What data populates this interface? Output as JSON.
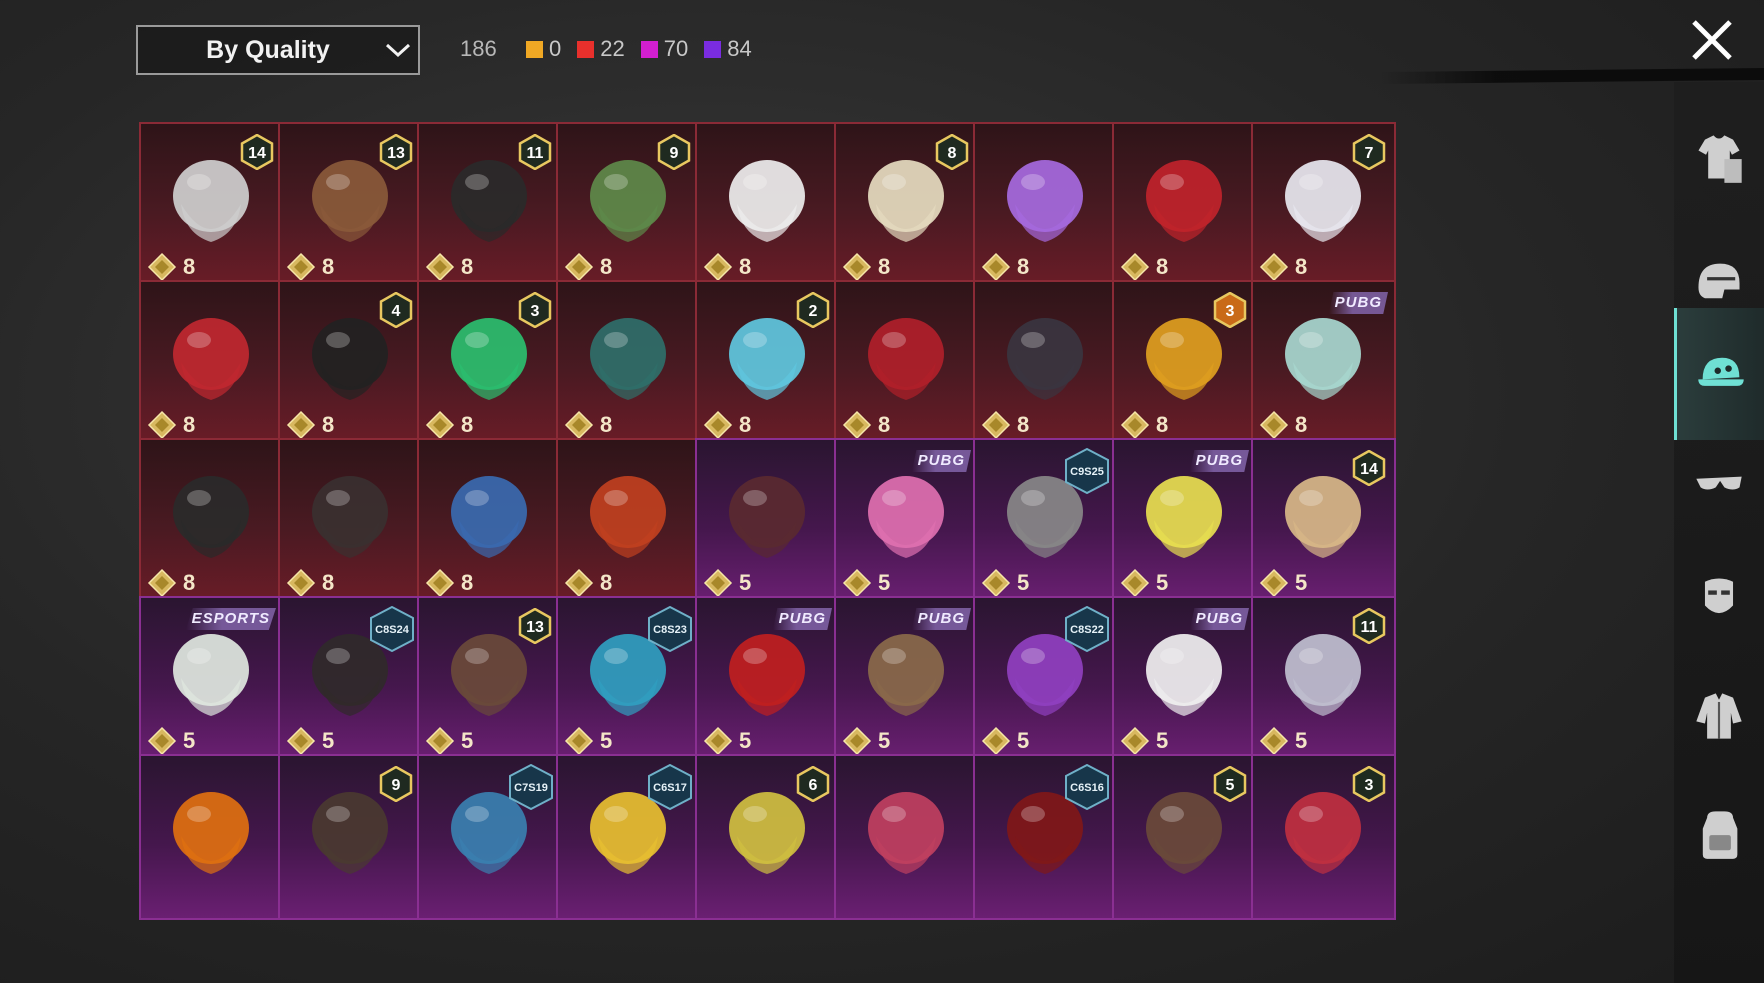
{
  "toolbar": {
    "sort_label": "By Quality",
    "total_count": "186",
    "quality_counts": [
      {
        "color": "#f0a824",
        "value": "0"
      },
      {
        "color": "#e8302c",
        "value": "22"
      },
      {
        "color": "#d21fd0",
        "value": "70"
      },
      {
        "color": "#7a2ce0",
        "value": "84"
      }
    ]
  },
  "items": [
    {
      "q": "r",
      "cost": "8",
      "badge": "14",
      "icon": "wolf-hood-icon"
    },
    {
      "q": "r",
      "cost": "8",
      "badge": "13",
      "icon": "flower-hat-icon"
    },
    {
      "q": "r",
      "cost": "8",
      "badge": "11",
      "icon": "dark-mask-icon"
    },
    {
      "q": "r",
      "cost": "8",
      "badge": "9",
      "icon": "zombie-head-icon"
    },
    {
      "q": "r",
      "cost": "8",
      "badge": "",
      "icon": "cowboy-hat-icon"
    },
    {
      "q": "r",
      "cost": "8",
      "badge": "8",
      "icon": "blonde-hair-icon"
    },
    {
      "q": "r",
      "cost": "8",
      "badge": "",
      "icon": "purple-hair-icon"
    },
    {
      "q": "r",
      "cost": "8",
      "badge": "",
      "icon": "demon-mask-icon"
    },
    {
      "q": "r",
      "cost": "8",
      "badge": "7",
      "icon": "white-hair-icon"
    },
    {
      "q": "r",
      "cost": "8",
      "badge": "",
      "icon": "red-helmet-icon"
    },
    {
      "q": "r",
      "cost": "8",
      "badge": "4",
      "icon": "snowman-hat-icon"
    },
    {
      "q": "r",
      "cost": "8",
      "badge": "3",
      "icon": "joker-head-icon"
    },
    {
      "q": "r",
      "cost": "8",
      "badge": "",
      "icon": "spiked-helmet-icon"
    },
    {
      "q": "r",
      "cost": "8",
      "badge": "2",
      "icon": "bucket-goggles-icon"
    },
    {
      "q": "r",
      "cost": "8",
      "badge": "",
      "icon": "oni-mask-icon"
    },
    {
      "q": "r",
      "cost": "8",
      "badge": "",
      "icon": "knight-helmet-icon"
    },
    {
      "q": "r",
      "cost": "8",
      "badge": "3",
      "icon": "fries-head-icon"
    },
    {
      "q": "r",
      "cost": "8",
      "brand": "PUBG",
      "icon": "cyber-helmet-icon"
    },
    {
      "q": "r",
      "cost": "8",
      "badge": "",
      "icon": "hood-mask-icon"
    },
    {
      "q": "r",
      "cost": "8",
      "badge": "",
      "icon": "pirate-hat-icon"
    },
    {
      "q": "r",
      "cost": "8",
      "badge": "",
      "icon": "dragon-head-icon"
    },
    {
      "q": "r",
      "cost": "8",
      "badge": "",
      "icon": "astro-helmet-icon"
    },
    {
      "q": "p",
      "cost": "5",
      "badge": "",
      "icon": "brown-hair-icon"
    },
    {
      "q": "p",
      "cost": "5",
      "brand": "PUBG",
      "icon": "bow-headband-icon"
    },
    {
      "q": "p",
      "cost": "5",
      "season": "C9S25",
      "icon": "grey-bun-hair-icon"
    },
    {
      "q": "p",
      "cost": "5",
      "brand": "PUBG",
      "icon": "box-head-icon"
    },
    {
      "q": "p",
      "cost": "5",
      "badge": "14",
      "icon": "flower-hair-icon"
    },
    {
      "q": "p",
      "cost": "5",
      "esports": "ESPORTS",
      "icon": "camo-bucket-hat-icon"
    },
    {
      "q": "p",
      "cost": "5",
      "season": "C8S24",
      "icon": "dark-bob-hair-icon"
    },
    {
      "q": "p",
      "cost": "5",
      "badge": "13",
      "icon": "aviator-cap-icon"
    },
    {
      "q": "p",
      "cost": "5",
      "season": "C8S23",
      "icon": "headphones-hair-icon"
    },
    {
      "q": "p",
      "cost": "5",
      "brand": "PUBG",
      "icon": "cap-glasses-icon"
    },
    {
      "q": "p",
      "cost": "5",
      "brand": "PUBG",
      "icon": "llama-head-icon"
    },
    {
      "q": "p",
      "cost": "5",
      "season": "C8S22",
      "icon": "purple-bob-hair-icon"
    },
    {
      "q": "p",
      "cost": "5",
      "brand": "PUBG",
      "icon": "panda-head-icon"
    },
    {
      "q": "p",
      "cost": "5",
      "badge": "11",
      "icon": "flower-veil-hair-icon"
    },
    {
      "q": "p",
      "cost": "",
      "badge": "",
      "icon": "pumpkin-head-icon"
    },
    {
      "q": "p",
      "cost": "",
      "badge": "9",
      "icon": "long-hair-icon"
    },
    {
      "q": "p",
      "cost": "",
      "season": "C7S19",
      "icon": "feather-headdress-icon"
    },
    {
      "q": "p",
      "cost": "",
      "season": "C6S17",
      "icon": "visor-hair-icon"
    },
    {
      "q": "p",
      "cost": "",
      "badge": "6",
      "icon": "knight-mask-icon"
    },
    {
      "q": "p",
      "cost": "",
      "badge": "",
      "icon": "witch-hat-icon"
    },
    {
      "q": "p",
      "cost": "",
      "season": "C6S16",
      "icon": "red-hair-icon"
    },
    {
      "q": "p",
      "cost": "",
      "badge": "5",
      "icon": "cat-ears-hair-icon"
    },
    {
      "q": "p",
      "cost": "",
      "badge": "3",
      "icon": "jester-hat-icon"
    }
  ],
  "sidebar": {
    "categories": [
      {
        "name": "outfit-icon",
        "active": false
      },
      {
        "name": "helmet-icon",
        "active": false
      },
      {
        "name": "cap-icon",
        "active": true
      },
      {
        "name": "glasses-icon",
        "active": false
      },
      {
        "name": "face-mask-icon",
        "active": false
      },
      {
        "name": "jacket-icon",
        "active": false
      },
      {
        "name": "backpack-icon",
        "active": false
      }
    ]
  }
}
